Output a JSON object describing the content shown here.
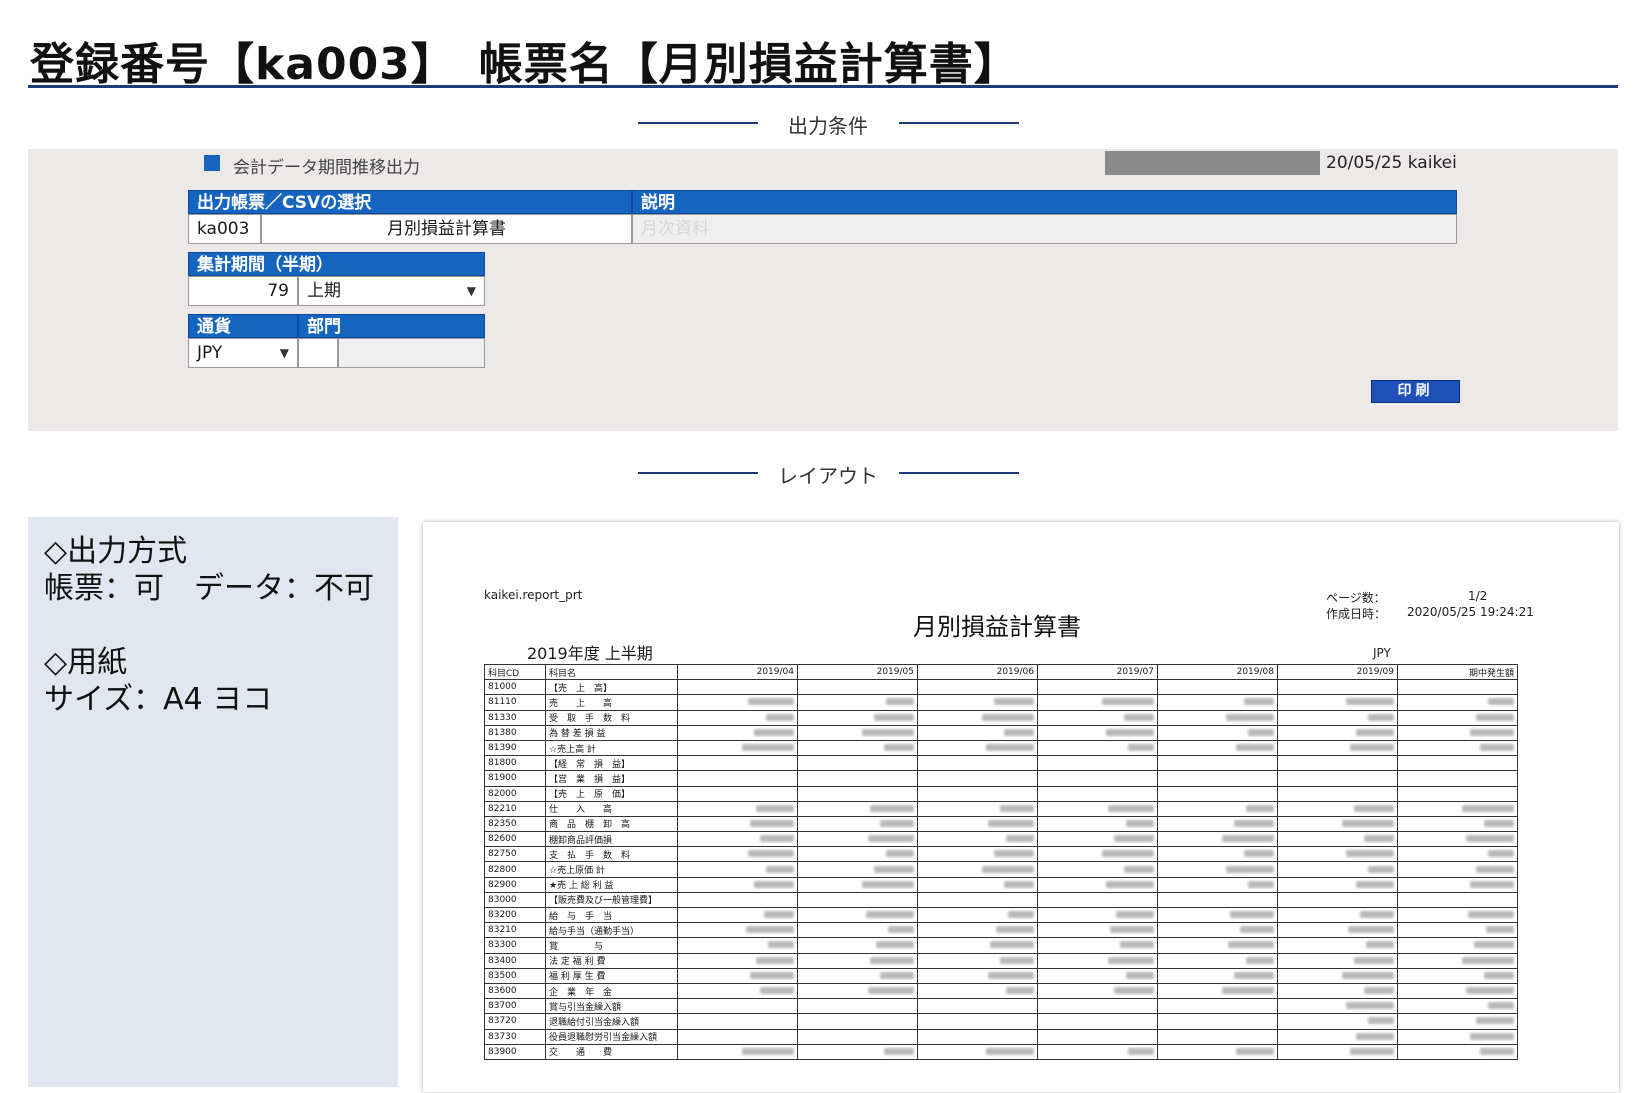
{
  "page": {
    "title": "登録番号【ka003】　帳票名【月別損益計算書】"
  },
  "sections": {
    "conditions": "出力条件",
    "layout": "レイアウト"
  },
  "conditions": {
    "caption": "会計データ期間推移出力",
    "stamp": "20/05/25 kaikei",
    "report_select": {
      "header_label": "出力帳票／CSVの選択",
      "desc_header": "説明",
      "code": "ka003",
      "name": "月別損益計算書",
      "description": "月次資料"
    },
    "period": {
      "header_label": "集計期間（半期）",
      "term": "79",
      "half": "上期"
    },
    "currency": {
      "header_label": "通貨",
      "value": "JPY"
    },
    "department": {
      "header_label": "部門",
      "code": "",
      "name": ""
    },
    "print_button": "印刷"
  },
  "info": {
    "output_heading": "◇出力方式",
    "output_detail": "帳票：可　データ：不可",
    "paper_heading": "◇用紙",
    "paper_detail": "サイズ：A4 ヨコ"
  },
  "report": {
    "program": "kaikei.report_prt",
    "title": "月別損益計算書",
    "pages_label": "ページ数：",
    "pages_value": "1/2",
    "created_label": "作成日時：",
    "created_value": "2020/05/25 19:24:21",
    "fiscal": "2019年度 上半期",
    "currency": "JPY",
    "columns": [
      "科目CD",
      "科目名",
      "2019/04",
      "2019/05",
      "2019/06",
      "2019/07",
      "2019/08",
      "2019/09",
      "期中発生額"
    ],
    "rows": [
      {
        "cd": "81000",
        "name": "【売　上　高】",
        "blank": true
      },
      {
        "cd": "81110",
        "name": "売　　上　　高"
      },
      {
        "cd": "81330",
        "name": "受　取　手　数　料"
      },
      {
        "cd": "81380",
        "name": "為 替 差 損 益"
      },
      {
        "cd": "81390",
        "name": "☆売上高 計"
      },
      {
        "cd": "81800",
        "name": "【経　常　損　益】",
        "blank": true
      },
      {
        "cd": "81900",
        "name": "【営　業　損　益】",
        "blank": true
      },
      {
        "cd": "82000",
        "name": "【売　上　原　価】",
        "blank": true
      },
      {
        "cd": "82210",
        "name": "仕　　入　　高"
      },
      {
        "cd": "82350",
        "name": "商　品　棚　卸　高"
      },
      {
        "cd": "82600",
        "name": "棚卸商品評価損"
      },
      {
        "cd": "82750",
        "name": "支　払　手　数　料"
      },
      {
        "cd": "82800",
        "name": "☆売上原価 計"
      },
      {
        "cd": "82900",
        "name": "★売 上 総 利 益"
      },
      {
        "cd": "83000",
        "name": "【販売費及び一般管理費】",
        "blank": true
      },
      {
        "cd": "83200",
        "name": "給　与　手　当"
      },
      {
        "cd": "83210",
        "name": "給与手当（通勤手当）"
      },
      {
        "cd": "83300",
        "name": "賞　　　　与"
      },
      {
        "cd": "83400",
        "name": "法 定 福 利 費"
      },
      {
        "cd": "83500",
        "name": "福 利 厚 生 費"
      },
      {
        "cd": "83600",
        "name": "企　業　年　金"
      },
      {
        "cd": "83700",
        "name": "賞与引当金繰入額",
        "partial": true
      },
      {
        "cd": "83720",
        "name": "退職給付引当金繰入額",
        "partial": true
      },
      {
        "cd": "83730",
        "name": "役員退職慰労引当金繰入額",
        "partial": true
      },
      {
        "cd": "83900",
        "name": "交　　通　　費"
      }
    ]
  }
}
